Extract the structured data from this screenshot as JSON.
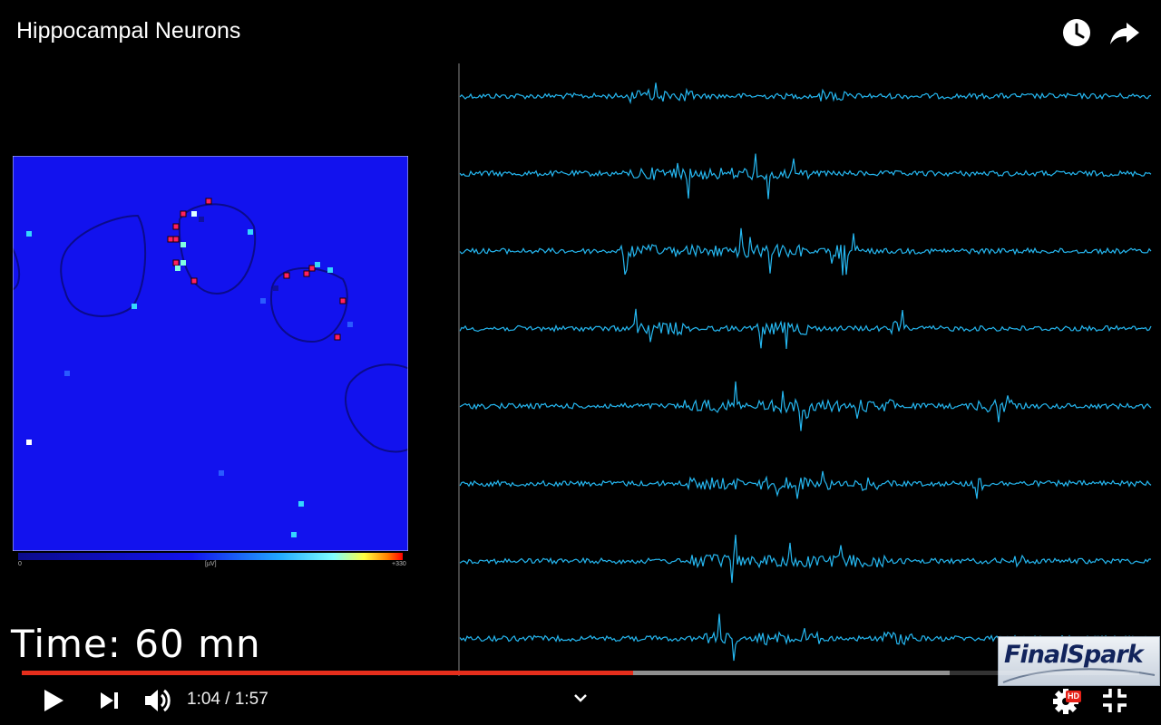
{
  "video": {
    "title": "Hippocampal Neurons",
    "current_time": "1:04",
    "separator": " / ",
    "duration": "1:57",
    "progress_fraction": 0.547,
    "buffered_fraction": 0.83,
    "hd_badge": "HD"
  },
  "overlay": {
    "time_label": "Time: 60 mn",
    "colorbar": {
      "min_label": "0",
      "unit_label": "[µV]",
      "max_label": "+330"
    },
    "logo_text": "FinalSpark"
  },
  "colors": {
    "background": "#000000",
    "progress_played": "#e52e1c",
    "trace": "#25b7f0",
    "heatmap_bg": "#1212ee",
    "hd_badge": "#e62117"
  },
  "icons": {
    "watch_later": "clock-icon",
    "share": "share-icon",
    "play": "play-icon",
    "next": "next-icon",
    "volume": "volume-icon",
    "more": "chevron-down-icon",
    "settings": "gear-icon",
    "exit_fullscreen": "exit-fullscreen-icon"
  }
}
